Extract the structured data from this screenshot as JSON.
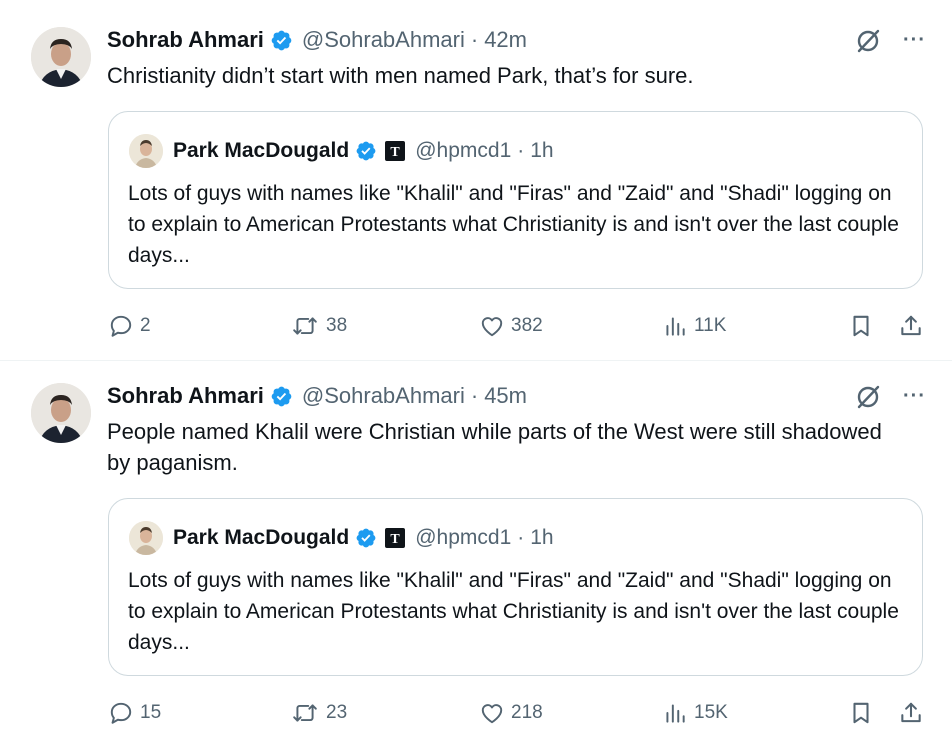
{
  "tweets": [
    {
      "author": "Sohrab Ahmari",
      "handle": "@SohrabAhmari",
      "separator": "·",
      "time": "42m",
      "text": "Christianity didn’t start with men named Park, that’s for sure.",
      "quote": {
        "author": "Park MacDougald",
        "handle": "@hpmcd1",
        "separator": "·",
        "time": "1h",
        "badge_letter": "T",
        "text": "Lots of guys with names like \"Khalil\" and \"Firas\" and \"Zaid\" and \"Shadi\" logging on to explain to American Protestants what Christianity is and isn't over the last couple days..."
      },
      "replies": "2",
      "reposts": "38",
      "likes": "382",
      "views": "11K"
    },
    {
      "author": "Sohrab Ahmari",
      "handle": "@SohrabAhmari",
      "separator": "·",
      "time": "45m",
      "text": "People named Khalil were Christian while parts of the West were still shadowed by paganism.",
      "quote": {
        "author": "Park MacDougald",
        "handle": "@hpmcd1",
        "separator": "·",
        "time": "1h",
        "badge_letter": "T",
        "text": "Lots of guys with names like \"Khalil\" and \"Firas\" and \"Zaid\" and \"Shadi\" logging on to explain to American Protestants what Christianity is and isn't over the last couple days..."
      },
      "replies": "15",
      "reposts": "23",
      "likes": "218",
      "views": "15K"
    }
  ],
  "more_label": "···",
  "colors": {
    "verified": "#1d9bf0",
    "secondary_text": "#536471",
    "border": "#cfd9de",
    "divider": "#eff3f4"
  },
  "icons": [
    "verified-icon",
    "grok-icon",
    "more-icon",
    "reply-icon",
    "repost-icon",
    "like-icon",
    "views-icon",
    "bookmark-icon",
    "share-icon"
  ]
}
